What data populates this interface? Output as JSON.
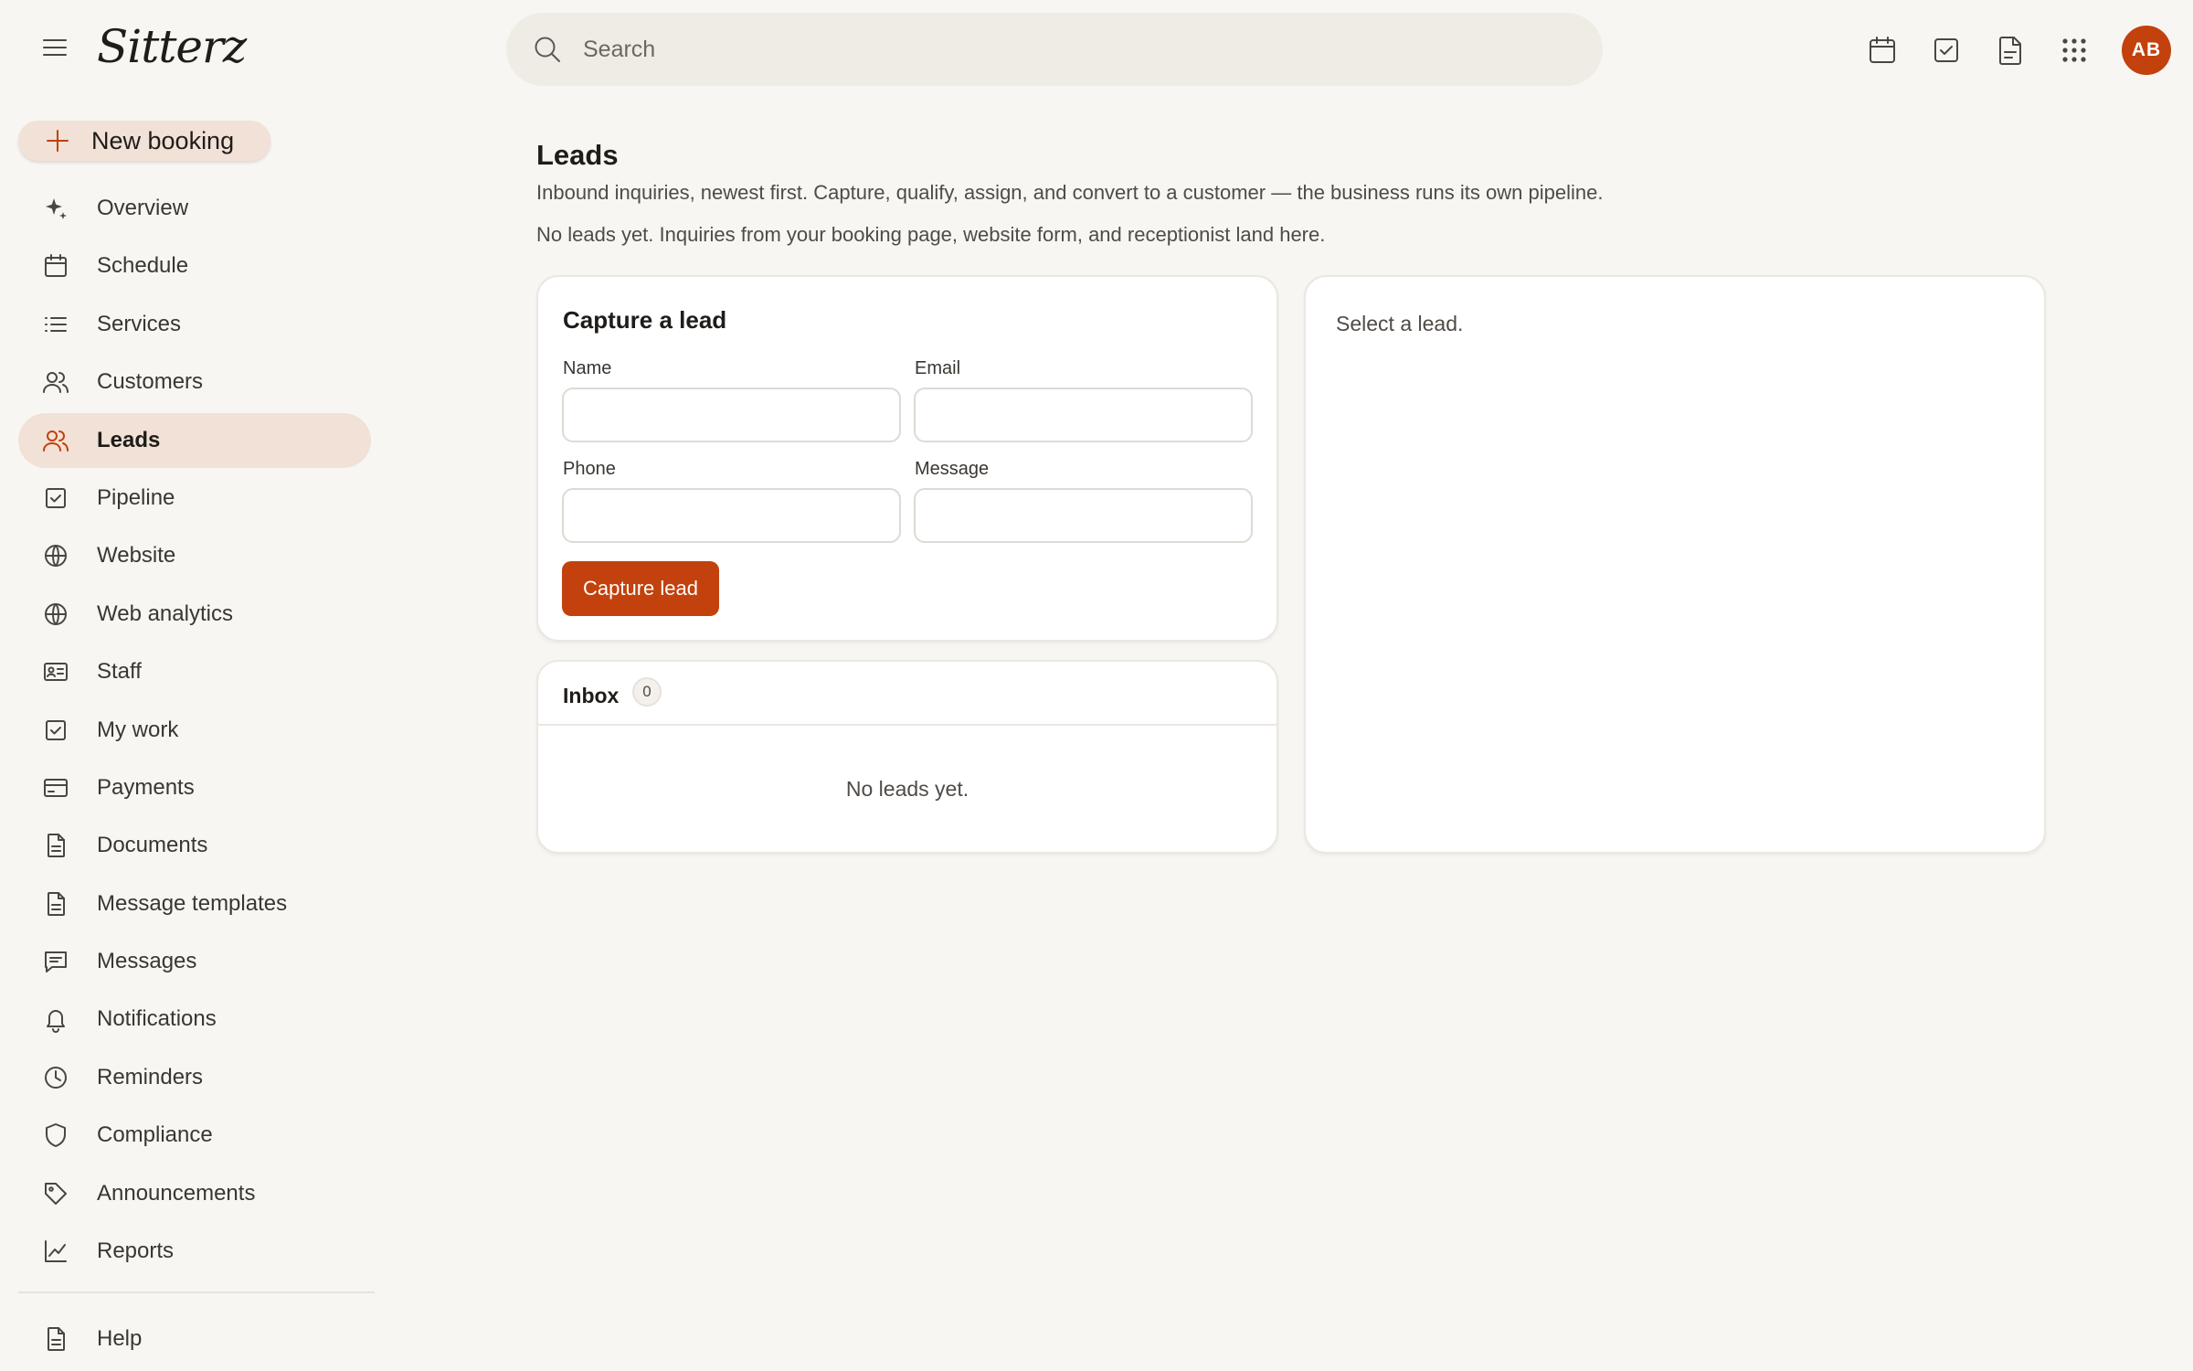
{
  "app": {
    "logo": "Sitterz"
  },
  "search": {
    "placeholder": "Search"
  },
  "header": {
    "icons": [
      "calendar-icon",
      "check-square-icon",
      "document-icon",
      "apps-grid-icon"
    ],
    "avatar_initials": "AB"
  },
  "colors": {
    "accent": "#c2410c",
    "active_bg": "#f1e1d6",
    "background": "#f8f6f2"
  },
  "sidebar": {
    "new_booking": "New booking",
    "items": [
      {
        "label": "Overview",
        "icon": "sparkle-icon"
      },
      {
        "label": "Schedule",
        "icon": "calendar-icon"
      },
      {
        "label": "Services",
        "icon": "list-icon"
      },
      {
        "label": "Customers",
        "icon": "users-icon"
      },
      {
        "label": "Leads",
        "icon": "users-icon",
        "active": true
      },
      {
        "label": "Pipeline",
        "icon": "check-square-icon"
      },
      {
        "label": "Website",
        "icon": "globe-icon"
      },
      {
        "label": "Web analytics",
        "icon": "globe-icon"
      },
      {
        "label": "Staff",
        "icon": "id-card-icon"
      },
      {
        "label": "My work",
        "icon": "check-square-icon"
      },
      {
        "label": "Payments",
        "icon": "credit-card-icon"
      },
      {
        "label": "Documents",
        "icon": "document-icon"
      },
      {
        "label": "Message templates",
        "icon": "document-icon"
      },
      {
        "label": "Messages",
        "icon": "message-icon"
      },
      {
        "label": "Notifications",
        "icon": "bell-icon"
      },
      {
        "label": "Reminders",
        "icon": "clock-icon"
      },
      {
        "label": "Compliance",
        "icon": "shield-icon"
      },
      {
        "label": "Announcements",
        "icon": "tag-icon"
      },
      {
        "label": "Reports",
        "icon": "chart-icon"
      }
    ],
    "help": "Help"
  },
  "main": {
    "title": "Leads",
    "description": "Inbound inquiries, newest first. Capture, qualify, assign, and convert to a customer — the business runs its own pipeline.",
    "empty_note": "No leads yet. Inquiries from your booking page, website form, and receptionist land here.",
    "capture": {
      "title": "Capture a lead",
      "name_label": "Name",
      "name_value": "",
      "email_label": "Email",
      "email_value": "",
      "phone_label": "Phone",
      "phone_value": "",
      "message_label": "Message",
      "message_value": "",
      "button": "Capture lead"
    },
    "inbox": {
      "title": "Inbox",
      "count": "0",
      "empty": "No leads yet."
    },
    "detail": {
      "placeholder": "Select a lead."
    }
  }
}
